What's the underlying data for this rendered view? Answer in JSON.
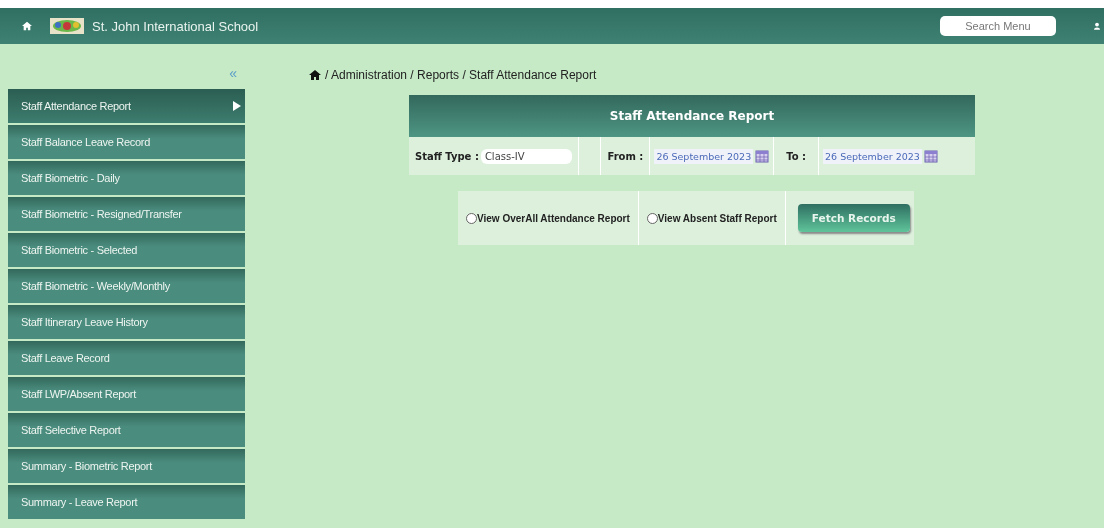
{
  "header": {
    "school_name": "St. John International School",
    "search": {
      "placeholder": "Search Menu"
    }
  },
  "sidebar": {
    "collapse": "«",
    "items": [
      {
        "label": "Staff Attendance Report",
        "selected": true
      },
      {
        "label": "Staff Balance Leave Record",
        "selected": false
      },
      {
        "label": "Staff Biometric - Daily",
        "selected": false
      },
      {
        "label": "Staff Biometric - Resigned/Transfer",
        "selected": false
      },
      {
        "label": "Staff Biometric - Selected",
        "selected": false
      },
      {
        "label": "Staff Biometric - Weekly/Monthly",
        "selected": false
      },
      {
        "label": "Staff Itinerary Leave History",
        "selected": false
      },
      {
        "label": "Staff Leave Record",
        "selected": false
      },
      {
        "label": "Staff LWP/Absent Report",
        "selected": false
      },
      {
        "label": "Staff Selective Report",
        "selected": false
      },
      {
        "label": "Summary - Biometric Report",
        "selected": false
      },
      {
        "label": "Summary - Leave Report",
        "selected": false
      }
    ]
  },
  "breadcrumb": "/ Administration / Reports / Staff Attendance Report",
  "form": {
    "title": "Staff Attendance Report",
    "staff_type_label": "Staff Type :",
    "staff_type": "Class-IV",
    "from_label": "From :",
    "from": "26 September 2023",
    "to_label": "To :",
    "to": "26 September 2023"
  },
  "options": [
    {
      "label": "View OverAll Attendance Report",
      "selected": false
    },
    {
      "label": "View Absent Staff Report",
      "selected": false
    }
  ],
  "fetch_button": "Fetch Records"
}
